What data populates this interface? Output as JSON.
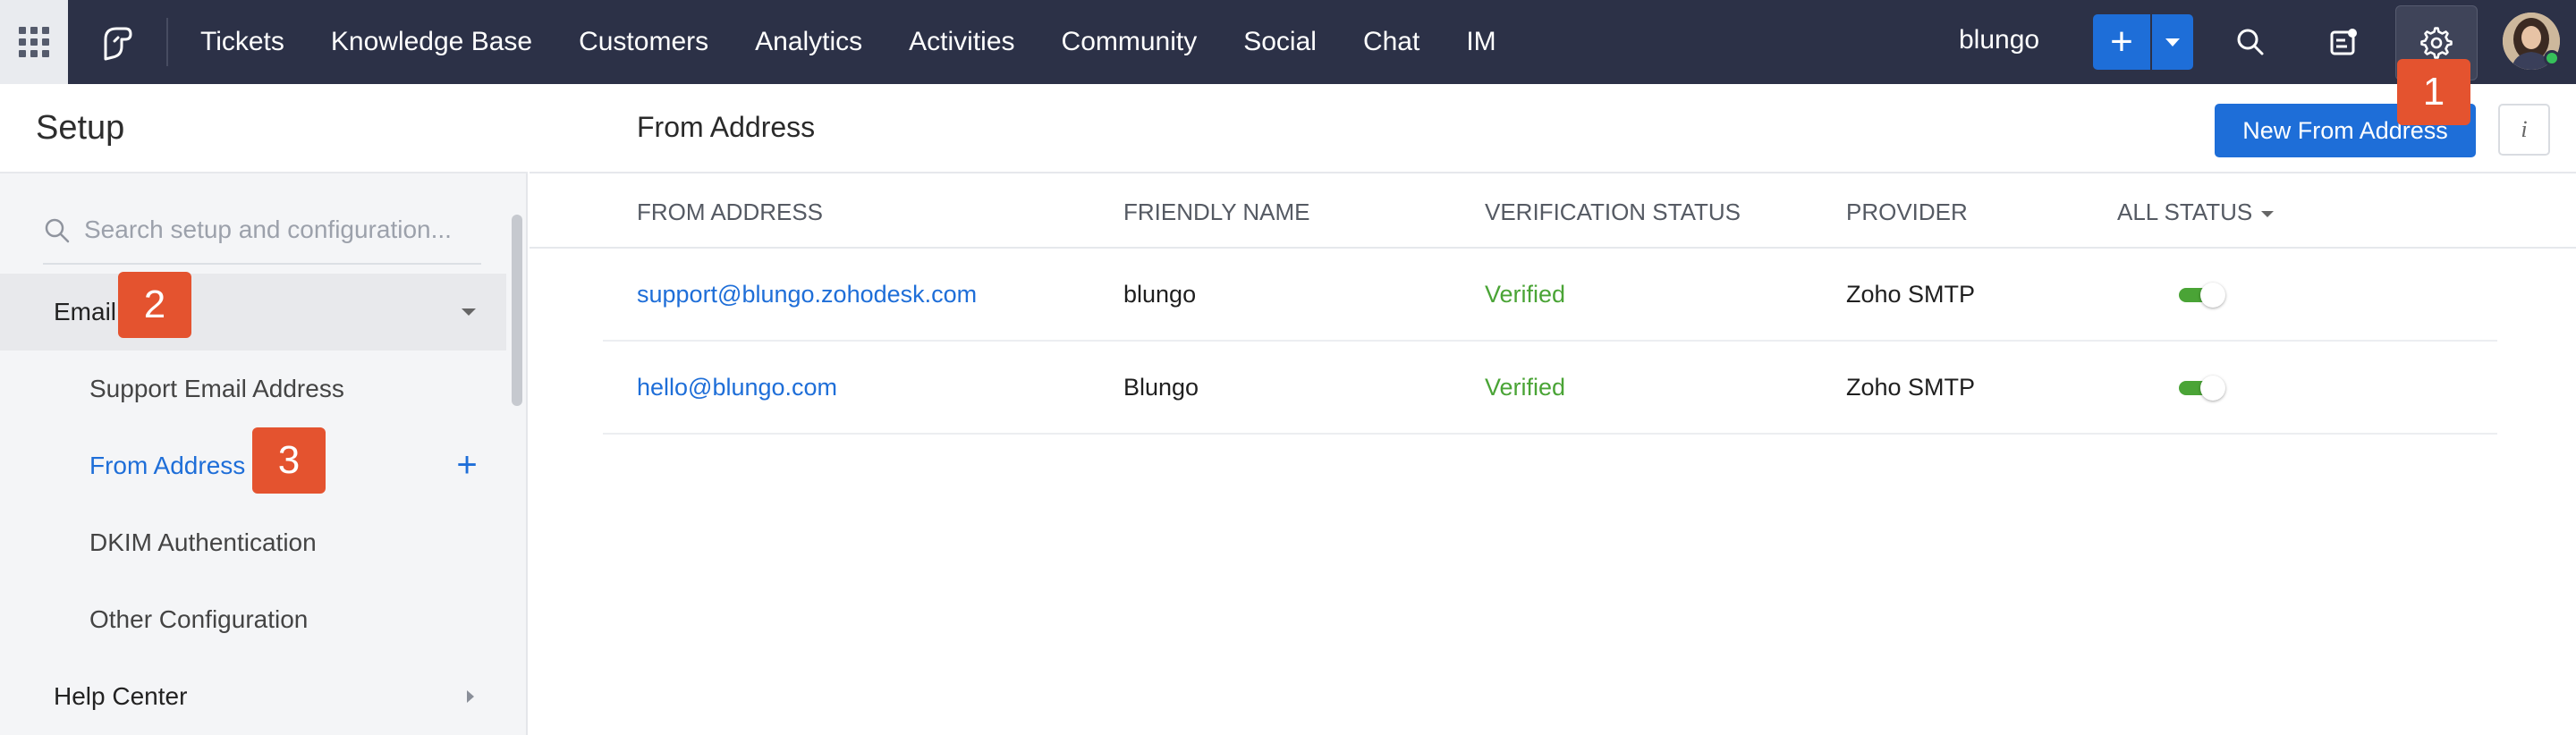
{
  "topbar": {
    "apps_icon": "grid-apps-icon",
    "logo_icon": "desk-logo-icon",
    "nav": [
      "Tickets",
      "Knowledge Base",
      "Customers",
      "Analytics",
      "Activities",
      "Community",
      "Social",
      "Chat",
      "IM"
    ],
    "org_name": "blungo",
    "add_label": "+",
    "icons": [
      "search-icon",
      "notes-icon",
      "gear-icon"
    ],
    "status_color": "#36c15a",
    "bar_color": "#2c3147"
  },
  "sidebar": {
    "title": "Setup",
    "search_placeholder": "Search setup and configuration...",
    "sections": [
      {
        "label": "Email",
        "expanded": true,
        "items": [
          {
            "label": "Support Email Address",
            "selected": false
          },
          {
            "label": "From Address",
            "selected": true
          },
          {
            "label": "DKIM Authentication",
            "selected": false
          },
          {
            "label": "Other Configuration",
            "selected": false
          }
        ]
      },
      {
        "label": "Help Center",
        "expanded": false
      }
    ]
  },
  "main": {
    "title": "From Address",
    "new_button": "New From Address",
    "info_label": "i",
    "columns": [
      "FROM ADDRESS",
      "FRIENDLY NAME",
      "VERIFICATION STATUS",
      "PROVIDER",
      "ALL STATUS"
    ],
    "rows": [
      {
        "address": "support@blungo.zohodesk.com",
        "friendly_name": "blungo",
        "status": "Verified",
        "provider": "Zoho SMTP",
        "enabled": true
      },
      {
        "address": "hello@blungo.com",
        "friendly_name": "Blungo",
        "status": "Verified",
        "provider": "Zoho SMTP",
        "enabled": true
      }
    ],
    "accent_color": "#1e6ed8",
    "verified_color": "#4aa436"
  },
  "callouts": [
    "1",
    "2",
    "3"
  ]
}
